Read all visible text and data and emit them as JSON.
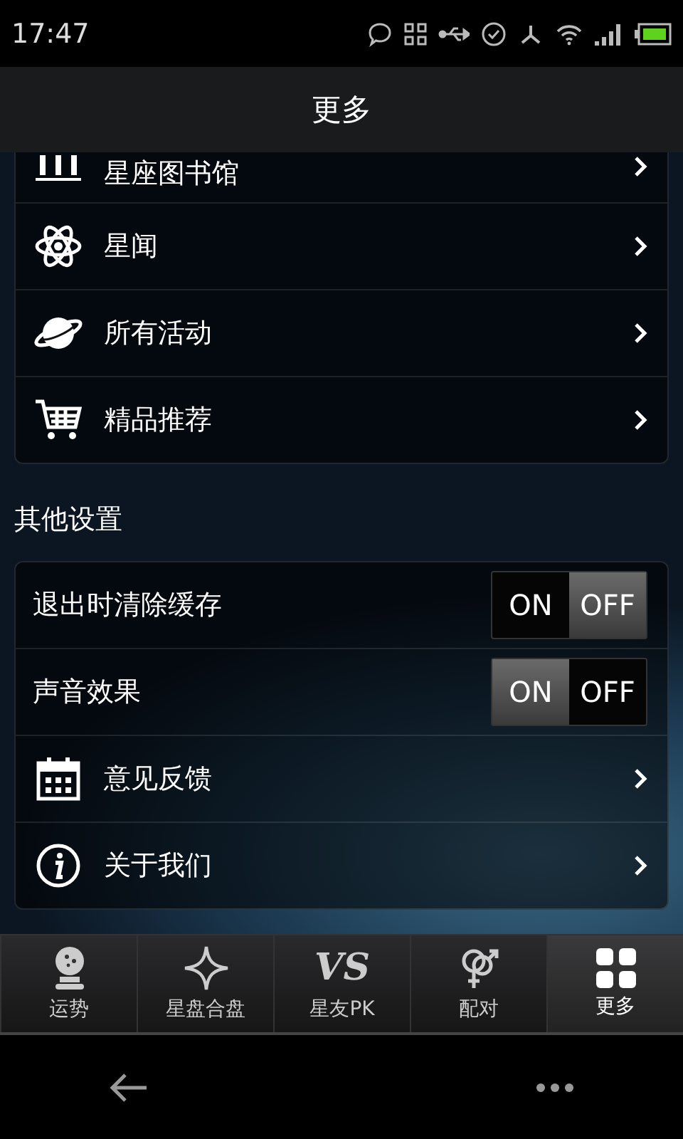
{
  "status_bar": {
    "time": "17:47"
  },
  "header": {
    "title": "更多"
  },
  "menu_items": [
    {
      "label": "星座图书馆"
    },
    {
      "label": "星闻"
    },
    {
      "label": "所有活动"
    },
    {
      "label": "精品推荐"
    }
  ],
  "section_title": "其他设置",
  "settings": [
    {
      "kind": "toggle",
      "label": "退出时清除缓存",
      "on_label": "ON",
      "off_label": "OFF",
      "on": false
    },
    {
      "kind": "toggle",
      "label": "声音效果",
      "on_label": "ON",
      "off_label": "OFF",
      "on": true
    },
    {
      "kind": "link",
      "label": "意见反馈"
    },
    {
      "kind": "link",
      "label": "关于我们"
    }
  ],
  "tabs": [
    {
      "label": "运势",
      "selected": false
    },
    {
      "label": "星盘合盘",
      "selected": false
    },
    {
      "label": "星友PK",
      "icon_text": "VS",
      "selected": false
    },
    {
      "label": "配对",
      "selected": false
    },
    {
      "label": "更多",
      "selected": true
    }
  ]
}
